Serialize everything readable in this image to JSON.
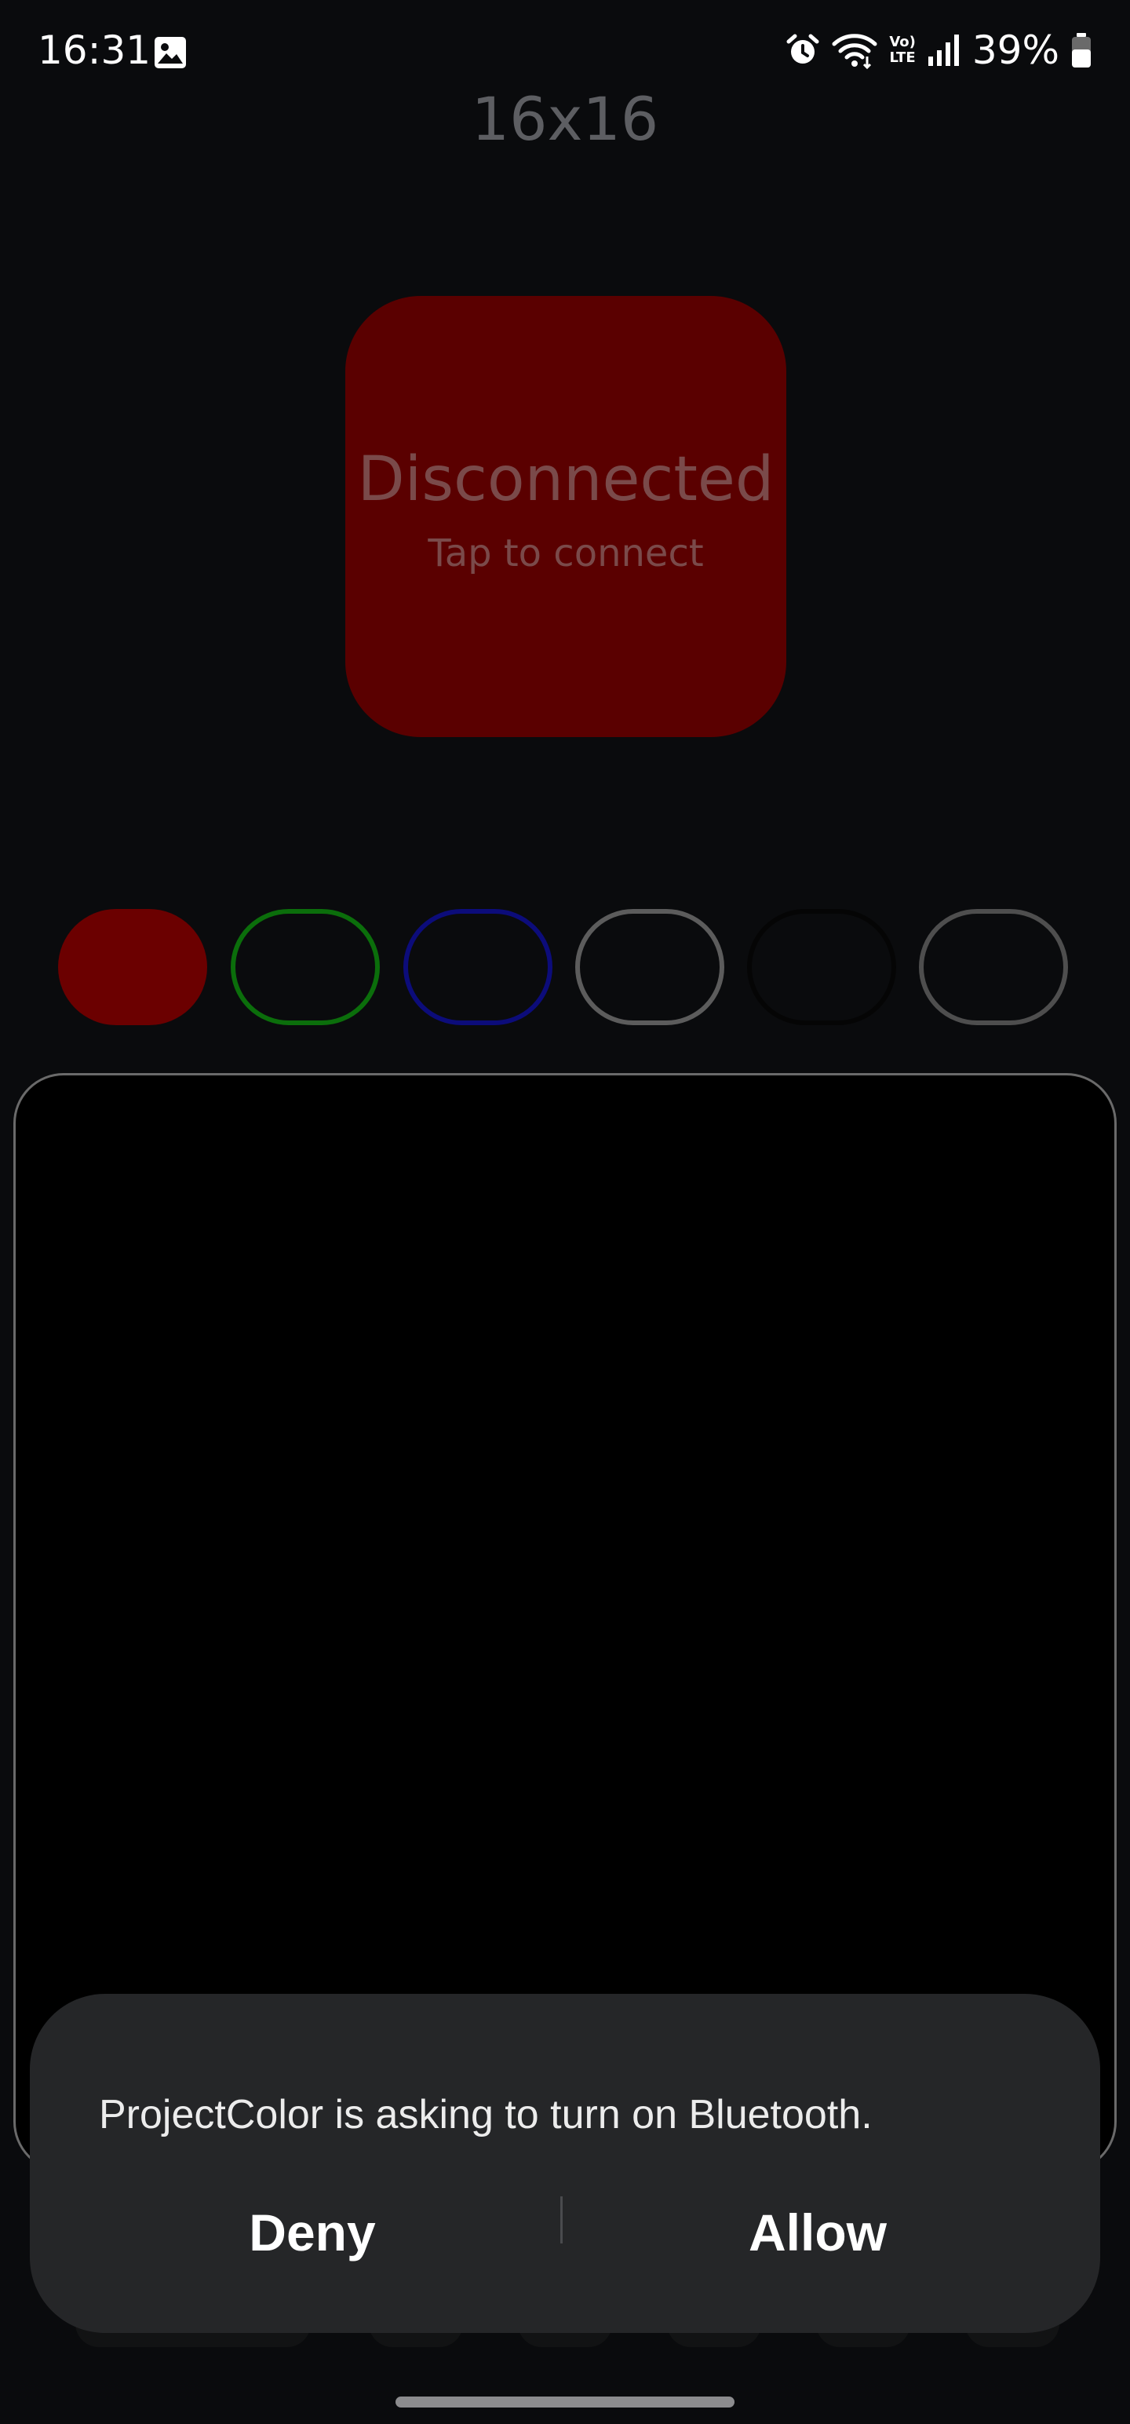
{
  "status_bar": {
    "time": "16:31",
    "gallery_icon": "image-icon",
    "alarm_icon": "alarm-icon",
    "wifi_icon": "wifi-icon",
    "volte_label_top": "Vo)",
    "volte_label_bottom": "LTE",
    "signal_icon": "signal-icon",
    "battery_percent": "39%",
    "battery_icon": "battery-icon"
  },
  "app": {
    "title": "16x16",
    "connection": {
      "status": "Disconnected",
      "hint": "Tap to connect",
      "color": "#5a0000"
    },
    "swatches": [
      {
        "name": "red",
        "fill": "#6b0000",
        "border": "#6b0000",
        "selected": true
      },
      {
        "name": "green",
        "fill": "transparent",
        "border": "#0b6e0b",
        "selected": false
      },
      {
        "name": "blue",
        "fill": "transparent",
        "border": "#0c0c7a",
        "selected": false
      },
      {
        "name": "white",
        "fill": "transparent",
        "border": "#5c5c5c",
        "selected": false
      },
      {
        "name": "black",
        "fill": "transparent",
        "border": "#050505",
        "selected": false
      },
      {
        "name": "gray",
        "fill": "transparent",
        "border": "#4e4e4e",
        "selected": false
      }
    ],
    "canvas_background": "#000000"
  },
  "dialog": {
    "message": "ProjectColor is asking to turn on Bluetooth.",
    "deny_label": "Deny",
    "allow_label": "Allow"
  }
}
